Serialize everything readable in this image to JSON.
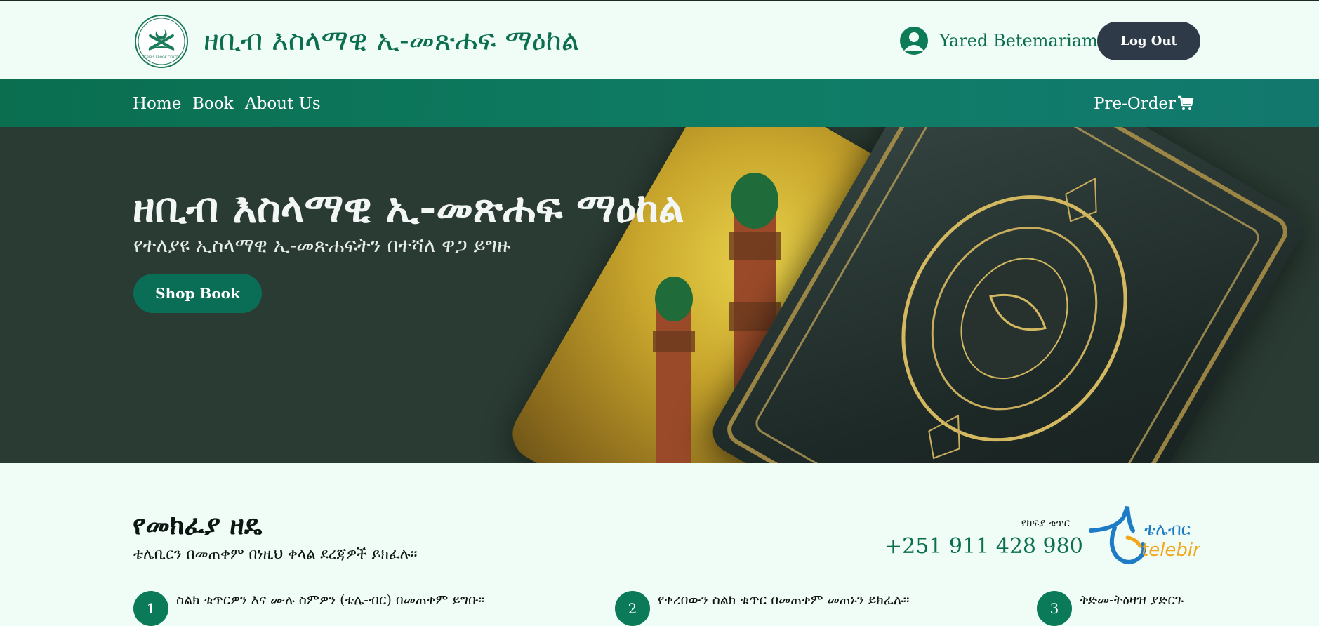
{
  "header": {
    "brand_title": "ዘቢብ እስላማዊ ኢ-መጽሐፍ ማዕከል",
    "user_name": "Yared Betemariam",
    "logout_label": "Log Out"
  },
  "nav": {
    "items": [
      {
        "label": "Home"
      },
      {
        "label": "Book"
      },
      {
        "label": "About Us"
      }
    ],
    "preorder_label": "Pre-Order"
  },
  "hero": {
    "title": "ዘቢብ እስላማዊ ኢ-መጽሐፍ ማዕከል",
    "subtitle": "የተለያዩ ኢስላማዊ ኢ-መጽሐፍትን በተሻለ ዋጋ ይግዙ",
    "cta_label": "Shop Book"
  },
  "payment": {
    "title": "የመክፈያ ዘዴ",
    "subtitle": "ቴሌቢርን በመጠቀም በነዚህ ቀላል ደረጃዎች ይክፈሉ።",
    "account_label": "የክፍያ ቁጥር",
    "account_number": "+251 911 428 980",
    "telebirr_amharic": "ቴሌብር",
    "telebirr_latin": "telebirr",
    "steps": [
      {
        "num": "1",
        "text": "ስልክ ቁጥርዎን እና ሙሉ ስምዎን (ቴሌ-ብር) በመጠቀም ይግቡ።"
      },
      {
        "num": "2",
        "text": "የቀረበውን ስልክ ቁጥር በመጠቀም መጠኑን ይክፈሉ።"
      },
      {
        "num": "3",
        "text": "ቅድመ-ትዕዛዝ ያድርጉ"
      }
    ]
  },
  "colors": {
    "brand_green": "#0a6e4f",
    "nav_green": "#0f7d66",
    "hero_bg": "#2a3b33",
    "logout_bg": "#2f3a49",
    "page_bg": "#f0fdf7",
    "telebirr_blue": "#1e7bc6",
    "telebirr_orange": "#f2a71b"
  },
  "icons": {
    "user": "user-circle-icon",
    "cart": "shopping-cart-icon"
  }
}
